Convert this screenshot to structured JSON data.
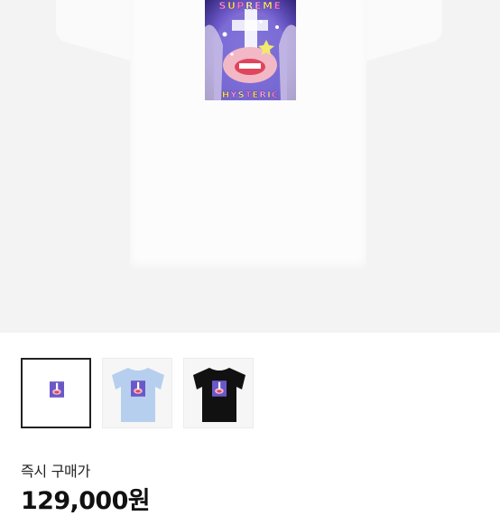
{
  "product": {
    "graphic": {
      "top_text": "SUPREME",
      "bottom_text": "HYSTERIC",
      "colors": {
        "letters_top": [
          "#ff8fc8",
          "#ffd84a",
          "#ff77c0",
          "#fff3a1",
          "#ff9bd0",
          "#ffe46a",
          "#ff7fbf"
        ],
        "letters_bottom": [
          "#ffe046",
          "#ff9bd6",
          "#fff08a",
          "#ff7fc0",
          "#ffd857",
          "#ffa6d9",
          "#ffe874",
          "#ff8cc6"
        ],
        "background": "#6b58c8",
        "face": "#f2b8c6",
        "lips": "#e0455c",
        "accent_star": "#f1ea6c"
      }
    },
    "thumbnails": [
      {
        "name": "white",
        "tee_color": "#ffffff",
        "selected": true
      },
      {
        "name": "light-blue",
        "tee_color": "#b7cfee",
        "selected": false
      },
      {
        "name": "black",
        "tee_color": "#111111",
        "selected": false
      }
    ]
  },
  "purchase": {
    "label": "즉시 구매가",
    "price": "129,000원"
  }
}
